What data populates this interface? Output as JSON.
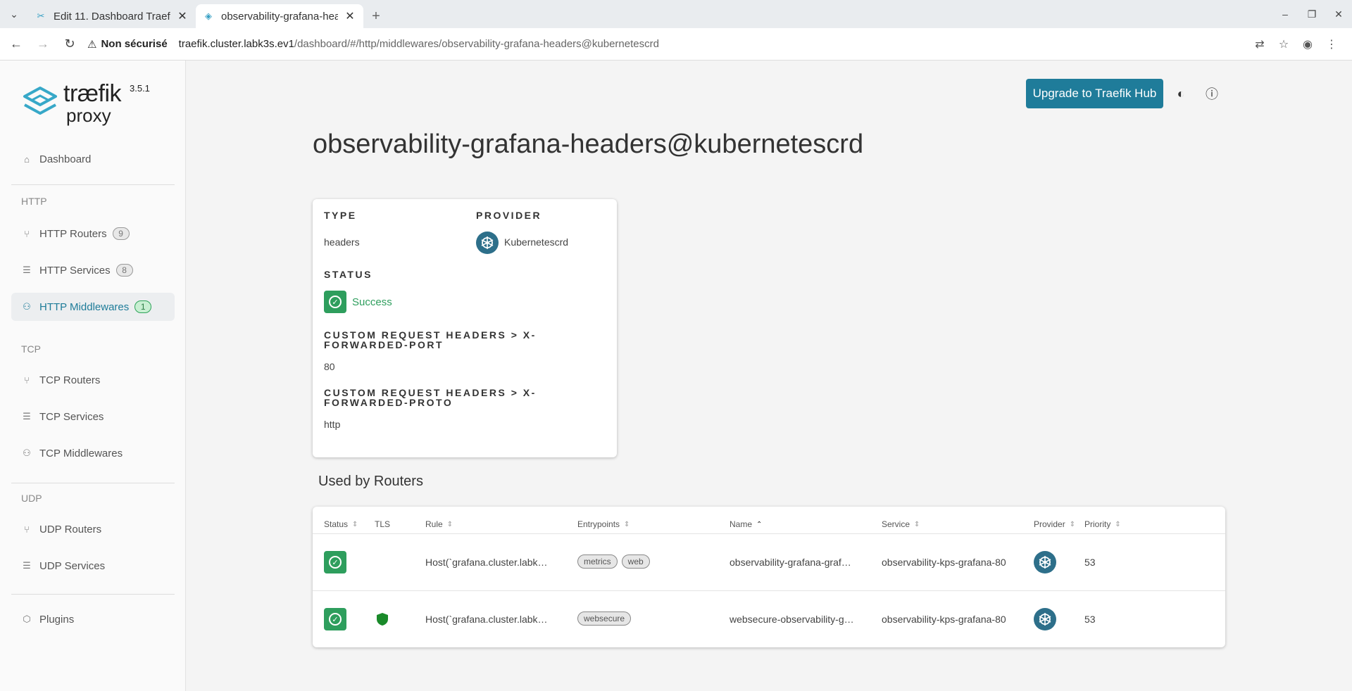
{
  "browser": {
    "tabs": [
      {
        "title": "Edit 11. Dashboard Traefik",
        "active": false
      },
      {
        "title": "observability-grafana-headers",
        "active": true
      }
    ],
    "insecure_label": "Non sécurisé",
    "url_host": "traefik.cluster.labk3s.ev1",
    "url_path": "/dashboard/#/http/middlewares/observability-grafana-headers@kubernetescrd"
  },
  "logo": {
    "brand": "træfik",
    "sub": "proxy",
    "version": "3.5.1"
  },
  "sidebar": {
    "dashboard": "Dashboard",
    "http_label": "HTTP",
    "http_routers": {
      "label": "HTTP Routers",
      "count": "9"
    },
    "http_services": {
      "label": "HTTP Services",
      "count": "8"
    },
    "http_middlewares": {
      "label": "HTTP Middlewares",
      "count": "1"
    },
    "tcp_label": "TCP",
    "tcp_routers": "TCP Routers",
    "tcp_services": "TCP Services",
    "tcp_middlewares": "TCP Middlewares",
    "udp_label": "UDP",
    "udp_routers": "UDP Routers",
    "udp_services": "UDP Services",
    "plugins": "Plugins"
  },
  "header": {
    "upgrade_label": "Upgrade to Traefik Hub"
  },
  "page_title": "observability-grafana-headers@kubernetescrd",
  "details": {
    "type_label": "TYPE",
    "type_value": "headers",
    "provider_label": "PROVIDER",
    "provider_value": "Kubernetescrd",
    "status_label": "STATUS",
    "status_value": "Success",
    "header1_label_line1": "CUSTOM REQUEST HEADERS > X-",
    "header1_label_line2": "FORWARDED-PORT",
    "header1_value": "80",
    "header2_label_line1": "CUSTOM REQUEST HEADERS > X-",
    "header2_label_line2": "FORWARDED-PROTO",
    "header2_value": "http"
  },
  "routers": {
    "title": "Used by Routers",
    "columns": {
      "status": "Status",
      "tls": "TLS",
      "rule": "Rule",
      "entrypoints": "Entrypoints",
      "name": "Name",
      "service": "Service",
      "provider": "Provider",
      "priority": "Priority"
    },
    "rows": [
      {
        "rule": "Host(`grafana.cluster.labk…",
        "entrypoints": [
          "metrics",
          "web"
        ],
        "name": "observability-grafana-graf…",
        "service": "observability-kps-grafana-80",
        "priority": "53",
        "tls": false
      },
      {
        "rule": "Host(`grafana.cluster.labk…",
        "entrypoints": [
          "websecure"
        ],
        "name": "websecure-observability-g…",
        "service": "observability-kps-grafana-80",
        "priority": "53",
        "tls": true
      }
    ]
  },
  "colors": {
    "accent": "#1f7c9a",
    "success": "#2e9e5d",
    "provider": "#2d6f8a"
  }
}
